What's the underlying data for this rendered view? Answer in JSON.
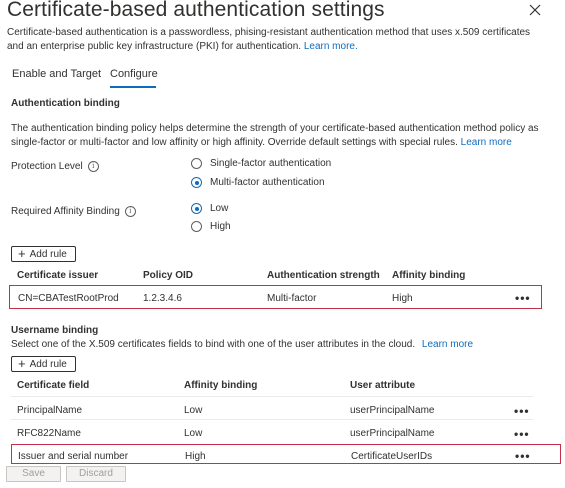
{
  "header": {
    "title": "Certificate-based authentication settings",
    "more_label": "···",
    "description": "Certificate-based authentication is a passwordless, phising-resistant authentication method that uses x.509 certificates and an enterprise public key infrastructure (PKI) for authentication.",
    "learn_more": "Learn more."
  },
  "tabs": [
    {
      "label": "Enable and Target",
      "active": false
    },
    {
      "label": "Configure",
      "active": true
    }
  ],
  "auth_binding": {
    "heading": "Authentication binding",
    "description": "The authentication binding policy helps determine the strength of your certificate-based authentication method policy as single-factor or multi-factor and low affinity or high affinity. Override default settings with special rules.",
    "learn_more": "Learn more",
    "protection_level": {
      "label": "Protection Level",
      "options": [
        "Single-factor authentication",
        "Multi-factor authentication"
      ],
      "selected": "Multi-factor authentication"
    },
    "affinity": {
      "label": "Required Affinity Binding",
      "options": [
        "Low",
        "High"
      ],
      "selected": "Low"
    },
    "add_rule": "Add rule",
    "table": {
      "headers": [
        "Certificate issuer",
        "Policy OID",
        "Authentication strength",
        "Affinity binding"
      ],
      "rows": [
        {
          "issuer": "CN=CBATestRootProd",
          "oid": "1.2.3.4.6",
          "strength": "Multi-factor",
          "affinity": "High",
          "more": "•••"
        }
      ]
    }
  },
  "username_binding": {
    "heading": "Username binding",
    "description": "Select one of the X.509 certificates fields to bind with one of the user attributes in the cloud.",
    "learn_more": "Learn more",
    "add_rule": "Add rule",
    "table": {
      "headers": [
        "Certificate field",
        "Affinity binding",
        "User attribute"
      ],
      "rows": [
        {
          "field": "PrincipalName",
          "affinity": "Low",
          "attribute": "userPrincipalName",
          "more": "•••"
        },
        {
          "field": "RFC822Name",
          "affinity": "Low",
          "attribute": "userPrincipalName",
          "more": "•••"
        },
        {
          "field": "Issuer and serial number",
          "affinity": "High",
          "attribute": "CertificateUserIDs",
          "more": "•••"
        }
      ]
    }
  },
  "footer": {
    "save": "Save",
    "discard": "Discard"
  },
  "colors": {
    "accent": "#0f6cbd",
    "highlight": "#c4314b"
  }
}
